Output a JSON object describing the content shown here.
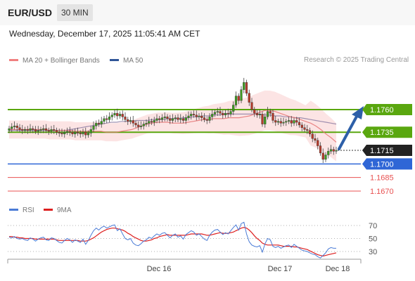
{
  "header": {
    "symbol": "EUR/USD",
    "timeframe": "30 MIN"
  },
  "datetime": "Wednesday, December 17, 2025 11:05:41 AM CET",
  "legend": {
    "ma20": {
      "label": "MA 20 + Bollinger Bands",
      "color": "#f08080"
    },
    "ma50": {
      "label": "MA 50",
      "color": "#2f5597"
    },
    "research": "Research © 2025 Trading Central"
  },
  "rsi_legend": {
    "rsi": {
      "label": "RSI",
      "color": "#4a7bd6"
    },
    "ma9": {
      "label": "9MA",
      "color": "#dd1f1f"
    }
  },
  "colors": {
    "green": "#5aa70f",
    "blue": "#2f66d6",
    "red": "#e85050",
    "dark": "#222222",
    "arrow": "#2d5fa8"
  },
  "chart_data": {
    "type": "candlestick",
    "price_levels": [
      {
        "label": "1.1760",
        "value": 1.176,
        "style": "green-line"
      },
      {
        "label": "1.1735",
        "value": 1.1735,
        "style": "green-line"
      },
      {
        "label": "1.1715",
        "value": 1.1715,
        "style": "current-price"
      },
      {
        "label": "1.1700",
        "value": 1.17,
        "style": "blue-line"
      },
      {
        "label": "1.1685",
        "value": 1.1685,
        "style": "red-line"
      },
      {
        "label": "1.1670",
        "value": 1.167,
        "style": "red-line"
      }
    ],
    "x_ticks": [
      "Dec 16",
      "Dec 17",
      "Dec 18"
    ],
    "close_series": [
      1.1739,
      1.1741,
      1.1742,
      1.174,
      1.1738,
      1.1737,
      1.1738,
      1.1737,
      1.1739,
      1.1738,
      1.1736,
      1.1737,
      1.1738,
      1.1739,
      1.1737,
      1.1736,
      1.1738,
      1.1737,
      1.1735,
      1.1734,
      1.1733,
      1.1735,
      1.1736,
      1.1735,
      1.1733,
      1.1735,
      1.1734,
      1.1733,
      1.1735,
      1.1732,
      1.1734,
      1.1738,
      1.1742,
      1.1745,
      1.1744,
      1.1747,
      1.175,
      1.1749,
      1.1752,
      1.1754,
      1.1756,
      1.1753,
      1.1755,
      1.1752,
      1.1749,
      1.1747,
      1.1748,
      1.1745,
      1.1743,
      1.1741,
      1.1742,
      1.1744,
      1.1745,
      1.1747,
      1.1746,
      1.1748,
      1.175,
      1.1749,
      1.1751,
      1.1752,
      1.175,
      1.1748,
      1.175,
      1.1751,
      1.1749,
      1.175,
      1.1748,
      1.1751,
      1.1753,
      1.1755,
      1.1754,
      1.1752,
      1.1753,
      1.1751,
      1.1749,
      1.1748,
      1.1752,
      1.1755,
      1.1757,
      1.1758,
      1.1756,
      1.1754,
      1.1756,
      1.1755,
      1.1758,
      1.1765,
      1.1775,
      1.177,
      1.1782,
      1.179,
      1.1778,
      1.1768,
      1.176,
      1.1756,
      1.1754,
      1.1755,
      1.1744,
      1.1752,
      1.1758,
      1.1756,
      1.1748,
      1.1746,
      1.1747,
      1.1745,
      1.1746,
      1.1747,
      1.1748,
      1.1745,
      1.1748,
      1.1746,
      1.1743,
      1.174,
      1.1738,
      1.1737,
      1.1733,
      1.1728,
      1.1726,
      1.172,
      1.1712,
      1.1705,
      1.171,
      1.1714,
      1.1716,
      1.1714,
      1.1715
    ],
    "ma20": [
      1.1738,
      1.1738,
      1.1738,
      1.1738,
      1.1738,
      1.1738,
      1.1738,
      1.1738,
      1.1737,
      1.1737,
      1.1737,
      1.1737,
      1.1737,
      1.1736,
      1.1736,
      1.1736,
      1.1736,
      1.1736,
      1.1736,
      1.1735,
      1.1735,
      1.1735,
      1.1736,
      1.1737,
      1.1738,
      1.174,
      1.1742,
      1.1744,
      1.1745,
      1.1746,
      1.1746,
      1.1746,
      1.1745,
      1.1745,
      1.1745,
      1.1746,
      1.1747,
      1.1748,
      1.1749,
      1.1749,
      1.175,
      1.175,
      1.175,
      1.1751,
      1.1751,
      1.1751,
      1.1752,
      1.1753,
      1.1755,
      1.1757,
      1.1759,
      1.1759,
      1.1758,
      1.1756,
      1.1754,
      1.1752,
      1.1751,
      1.1749,
      1.1747,
      1.1745,
      1.1742,
      1.1738,
      1.1733,
      1.1729,
      1.1724
    ],
    "ma50": [
      1.1737,
      1.1737,
      1.1737,
      1.1737,
      1.1737,
      1.1737,
      1.1737,
      1.1737,
      1.1737,
      1.1737,
      1.1737,
      1.1737,
      1.1738,
      1.1739,
      1.174,
      1.1741,
      1.1742,
      1.1743,
      1.1744,
      1.1745,
      1.1746,
      1.1746,
      1.1747,
      1.1747,
      1.1747,
      1.1748,
      1.1748,
      1.1748,
      1.1749,
      1.1749,
      1.1749,
      1.175,
      1.175,
      1.175,
      1.1751,
      1.1751,
      1.1752,
      1.1752,
      1.1753,
      1.1753,
      1.1754,
      1.1754,
      1.1755,
      1.1755,
      1.1755,
      1.1755,
      1.1755,
      1.1755,
      1.1755,
      1.1755,
      1.1754,
      1.1754,
      1.1753,
      1.1753,
      1.1752,
      1.1752,
      1.1751,
      1.1751,
      1.175,
      1.1749,
      1.1748,
      1.1747,
      1.1746,
      1.1745,
      1.1744
    ],
    "rsi_levels": [
      70,
      50,
      30
    ],
    "rsi": [
      52,
      51,
      53,
      50,
      49,
      50,
      48,
      47,
      51,
      49,
      46,
      49,
      51,
      52,
      48,
      47,
      51,
      50,
      47,
      44,
      43,
      47,
      50,
      48,
      44,
      48,
      46,
      44,
      49,
      41,
      47,
      55,
      62,
      66,
      63,
      67,
      69,
      66,
      68,
      70,
      71,
      62,
      65,
      57,
      50,
      48,
      50,
      43,
      40,
      39,
      42,
      46,
      48,
      52,
      50,
      54,
      57,
      55,
      58,
      59,
      55,
      51,
      55,
      57,
      52,
      54,
      49,
      56,
      59,
      62,
      60,
      55,
      57,
      53,
      49,
      47,
      55,
      60,
      63,
      64,
      60,
      56,
      59,
      57,
      62,
      67,
      71,
      63,
      73,
      75,
      57,
      45,
      40,
      38,
      37,
      39,
      29,
      42,
      50,
      48,
      38,
      36,
      38,
      35,
      37,
      39,
      40,
      36,
      41,
      38,
      35,
      32,
      31,
      30,
      28,
      26,
      25,
      22,
      20,
      24,
      28,
      34,
      36,
      35,
      35
    ],
    "rsi_ma9": [
      53,
      53,
      52,
      52,
      51,
      51,
      50,
      50,
      50,
      50,
      49,
      49,
      49,
      49,
      49,
      49,
      49,
      49,
      48,
      47,
      47,
      47,
      47,
      47,
      47,
      47,
      47,
      46,
      46,
      46,
      47,
      49,
      51,
      54,
      57,
      60,
      62,
      64,
      65,
      66,
      66,
      65,
      64,
      63,
      61,
      58,
      56,
      53,
      51,
      49,
      47,
      46,
      46,
      47,
      48,
      50,
      51,
      53,
      54,
      55,
      56,
      55,
      55,
      55,
      55,
      55,
      55,
      55,
      56,
      57,
      57,
      57,
      57,
      57,
      56,
      55,
      55,
      56,
      57,
      58,
      59,
      58,
      58,
      58,
      59,
      60,
      62,
      64,
      66,
      67,
      66,
      63,
      59,
      54,
      50,
      47,
      43,
      41,
      40,
      40,
      40,
      40,
      40,
      39,
      38,
      38,
      38,
      38,
      37,
      37,
      36,
      35,
      34,
      33,
      31,
      29,
      27,
      25,
      24,
      23,
      24,
      25,
      26,
      27,
      28
    ]
  }
}
